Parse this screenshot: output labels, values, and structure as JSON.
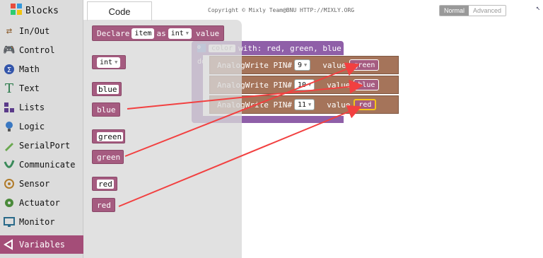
{
  "sidebar": {
    "title": "Blocks",
    "items": [
      {
        "label": "In/Out",
        "icon": "in-out-arrows-icon"
      },
      {
        "label": "Control",
        "icon": "gamepad-icon"
      },
      {
        "label": "Math",
        "icon": "math-circle-icon"
      },
      {
        "label": "Text",
        "icon": "letter-t-icon"
      },
      {
        "label": "Lists",
        "icon": "list-blocks-icon"
      },
      {
        "label": "Logic",
        "icon": "bulb-icon"
      },
      {
        "label": "SerialPort",
        "icon": "pen-icon"
      },
      {
        "label": "Communicate",
        "icon": "swirl-icon"
      },
      {
        "label": "Sensor",
        "icon": "signal-icon"
      },
      {
        "label": "Actuator",
        "icon": "gear-icon"
      },
      {
        "label": "Monitor",
        "icon": "monitor-icon"
      },
      {
        "label": "Variables",
        "icon": "variable-icon"
      }
    ]
  },
  "tabs": {
    "code": "Code"
  },
  "copyright": "Copyright © Mixly Team@BNU HTTP://MIXLY.ORG",
  "mode": {
    "normal": "Normal",
    "advanced": "Advanced"
  },
  "flyout": {
    "declare": {
      "prefix": "Declare",
      "name": "item",
      "as": "as",
      "type": "int",
      "value": "value"
    },
    "int_block": "int",
    "vars": [
      "blue",
      "blue",
      "green",
      "green",
      "red",
      "red"
    ]
  },
  "program": {
    "header_color_label": "color",
    "header_params": "with: red, green, blue",
    "do_label": "do",
    "rows": [
      {
        "label": "AnalogWrite PIN#",
        "pin": "9",
        "value_label": "value",
        "var": "green"
      },
      {
        "label": "AnalogWrite PIN#",
        "pin": "10",
        "value_label": "value",
        "var": "blue"
      },
      {
        "label": "AnalogWrite PIN#",
        "pin": "11",
        "value_label": "value",
        "var": "red"
      }
    ]
  },
  "colors": {
    "variable": "#a55b80",
    "procedure": "#8f5fa8",
    "analog": "#a5745a",
    "arrow": "#f24040",
    "active_sidebar": "#a44d78"
  }
}
